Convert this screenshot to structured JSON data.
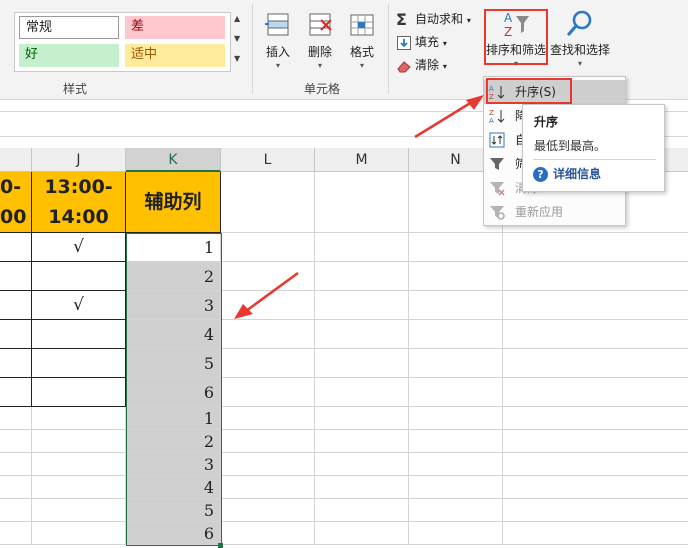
{
  "ribbon": {
    "styles": {
      "normal": "常规",
      "bad": "差",
      "good": "好",
      "neutral": "适中",
      "group_label": "样式"
    },
    "cells_group": {
      "insert": "插入",
      "delete": "删除",
      "format": "格式",
      "group_label": "单元格"
    },
    "editing": {
      "autosum": "自动求和",
      "fill": "填充",
      "clear": "清除",
      "sort_filter": "排序和筛选",
      "find_select": "查找和选择"
    }
  },
  "columns": [
    "J",
    "K",
    "L",
    "M",
    "N"
  ],
  "header_row": {
    "i_line1": "0-",
    "i_line2": "00",
    "j_line1": "13:00-",
    "j_line2": "14:00",
    "k": "辅助列"
  },
  "j_checks": [
    "√",
    "",
    "√",
    "",
    "",
    ""
  ],
  "k_values": [
    "1",
    "2",
    "3",
    "4",
    "5",
    "6",
    "1",
    "2",
    "3",
    "4",
    "5",
    "6"
  ],
  "menu": {
    "ascending": "升序(S)",
    "descending": "降",
    "custom": "自",
    "filter": "筛",
    "clear": "清除",
    "reapply": "重新应用"
  },
  "tooltip": {
    "title": "升序",
    "desc": "最低到最高。",
    "more": "详细信息"
  },
  "colors": {
    "header_fill": "#ffc000",
    "selection_fill": "#d0d0d0",
    "selection_border": "#217346",
    "highlight": "#e8382f",
    "cell_bad": "#ffc7ce",
    "cell_good": "#c6efce",
    "cell_neutral": "#ffeb9c"
  }
}
